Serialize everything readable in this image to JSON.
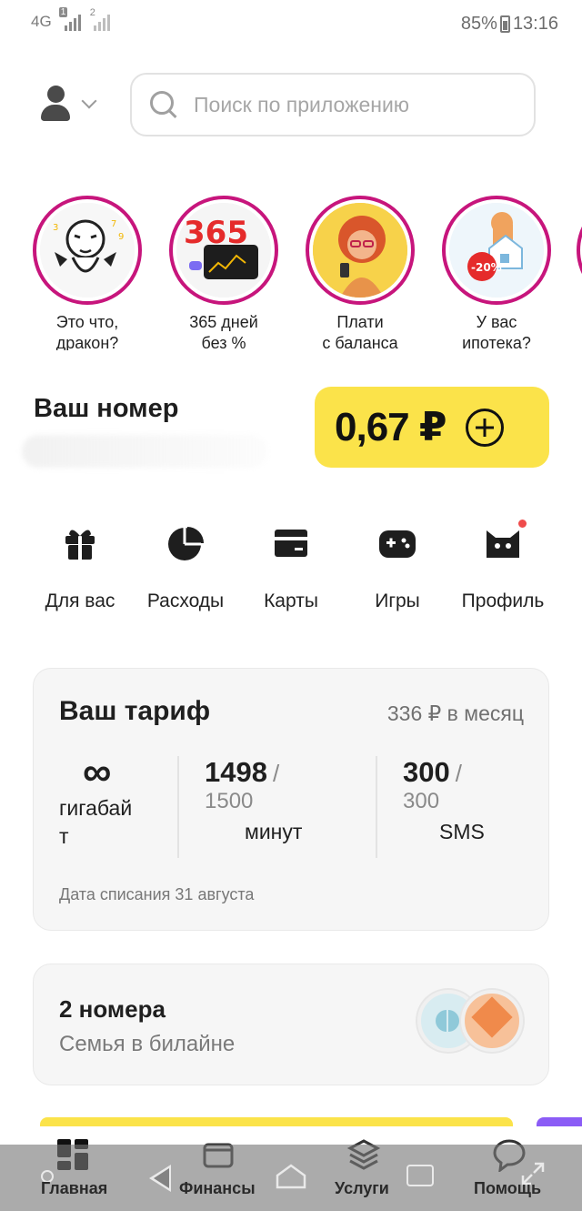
{
  "status_bar": {
    "network": "4G",
    "sim1_badge": "1",
    "sim2_badge": "2",
    "battery": "85%",
    "time": "13:16"
  },
  "header": {
    "search_placeholder": "Поиск по приложению"
  },
  "stories": [
    {
      "caption": "Это что,\nдракон?",
      "icon": "dragon-illustration"
    },
    {
      "caption": "365 дней\nбез %",
      "icon": "credit-card-illustration",
      "art_text": "365"
    },
    {
      "caption": "Плати\nс баланса",
      "icon": "woman-with-phone-illustration"
    },
    {
      "caption": "У вас\nипотека?",
      "icon": "house-discount-illustration",
      "art_text": "-20%"
    }
  ],
  "number": {
    "title": "Ваш номер"
  },
  "balance": {
    "amount": "0,67 ₽"
  },
  "quick_actions": [
    {
      "label": "Для вас",
      "icon": "gift-icon"
    },
    {
      "label": "Расходы",
      "icon": "pie-chart-icon"
    },
    {
      "label": "Карты",
      "icon": "card-icon"
    },
    {
      "label": "Игры",
      "icon": "gamepad-icon"
    },
    {
      "label": "Профиль",
      "icon": "cat-profile-icon",
      "notification": true
    }
  ],
  "tariff": {
    "title": "Ваш тариф",
    "price": "336 ₽ в месяц",
    "internet_value": "∞",
    "internet_unit": "гигабай\nт",
    "minutes_used": "1498",
    "minutes_total": "1500",
    "minutes_unit": "минут",
    "sms_used": "300",
    "sms_total": "300",
    "sms_unit": "SMS",
    "charge_date": "Дата списания 31 августа"
  },
  "family": {
    "title": "2 номера",
    "subtitle": "Семья в билайне"
  },
  "tabs": [
    {
      "label": "Главная",
      "icon": "dashboard-icon",
      "active": true
    },
    {
      "label": "Финансы",
      "icon": "wallet-icon"
    },
    {
      "label": "Услуги",
      "icon": "layers-icon"
    },
    {
      "label": "Помощь",
      "icon": "chat-bubble-icon"
    }
  ],
  "colors": {
    "accent_yellow": "#fbe34a",
    "story_ring": "#c7157c",
    "notification": "#ef4b4b"
  }
}
